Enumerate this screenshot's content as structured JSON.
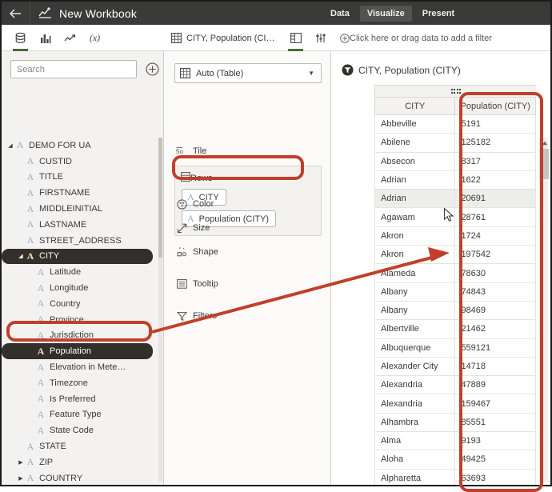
{
  "header": {
    "back_icon": "back-arrow-icon",
    "workbook_icon": "chart-icon",
    "title": "New Workbook",
    "nav": [
      {
        "label": "Data",
        "active": false
      },
      {
        "label": "Visualize",
        "active": true
      },
      {
        "label": "Present",
        "active": false
      }
    ]
  },
  "left_panel": {
    "toolbar_icons": [
      {
        "name": "database-icon",
        "selected": true
      },
      {
        "name": "bar-chart-icon",
        "selected": false
      },
      {
        "name": "trend-line-icon",
        "selected": false
      },
      {
        "name": "formula-icon",
        "selected": false,
        "glyph": "(x)"
      }
    ],
    "search": {
      "placeholder": "Search",
      "value": ""
    },
    "add_button": "add-circle-icon",
    "tree": [
      {
        "label": "DEMO FOR UA",
        "indent": 0,
        "caret": "down",
        "icon": "dataset-icon",
        "selected": false
      },
      {
        "label": "CUSTID",
        "indent": 1,
        "caret": "none",
        "icon": "text-field-icon",
        "selected": false
      },
      {
        "label": "TITLE",
        "indent": 1,
        "caret": "none",
        "icon": "text-field-icon",
        "selected": false
      },
      {
        "label": "FIRSTNAME",
        "indent": 1,
        "caret": "none",
        "icon": "text-field-icon",
        "selected": false
      },
      {
        "label": "MIDDLEINITIAL",
        "indent": 1,
        "caret": "none",
        "icon": "text-field-icon",
        "selected": false
      },
      {
        "label": "LASTNAME",
        "indent": 1,
        "caret": "none",
        "icon": "text-field-icon",
        "selected": false
      },
      {
        "label": "STREET_ADDRESS",
        "indent": 1,
        "caret": "none",
        "icon": "text-field-icon",
        "selected": false
      },
      {
        "label": "CITY",
        "indent": 1,
        "caret": "down",
        "icon": "text-field-icon",
        "selected": true
      },
      {
        "label": "Latitude",
        "indent": 2,
        "caret": "none",
        "icon": "text-field-icon",
        "selected": false
      },
      {
        "label": "Longitude",
        "indent": 2,
        "caret": "none",
        "icon": "text-field-icon",
        "selected": false
      },
      {
        "label": "Country",
        "indent": 2,
        "caret": "none",
        "icon": "text-field-icon",
        "selected": false
      },
      {
        "label": "Province",
        "indent": 2,
        "caret": "none",
        "icon": "text-field-icon",
        "selected": false
      },
      {
        "label": "Jurisdiction",
        "indent": 2,
        "caret": "none",
        "icon": "text-field-icon",
        "selected": false
      },
      {
        "label": "Population",
        "indent": 2,
        "caret": "none",
        "icon": "text-field-icon",
        "selected": true
      },
      {
        "label": "Elevation in Mete…",
        "indent": 2,
        "caret": "none",
        "icon": "text-field-icon",
        "selected": false
      },
      {
        "label": "Timezone",
        "indent": 2,
        "caret": "none",
        "icon": "text-field-icon",
        "selected": false
      },
      {
        "label": "Is Preferred",
        "indent": 2,
        "caret": "none",
        "icon": "text-field-icon",
        "selected": false
      },
      {
        "label": "Feature Type",
        "indent": 2,
        "caret": "none",
        "icon": "text-field-icon",
        "selected": false
      },
      {
        "label": "State Code",
        "indent": 2,
        "caret": "none",
        "icon": "text-field-icon",
        "selected": false
      },
      {
        "label": "STATE",
        "indent": 1,
        "caret": "none",
        "icon": "text-field-icon",
        "selected": false
      },
      {
        "label": "ZIP",
        "indent": 1,
        "caret": "right",
        "icon": "text-field-icon",
        "selected": false
      },
      {
        "label": "COUNTRY",
        "indent": 1,
        "caret": "right",
        "icon": "text-field-icon",
        "selected": false
      }
    ]
  },
  "mid_panel": {
    "tab": {
      "label": "CITY, Population (CI…",
      "icon": "table-icon"
    },
    "tab_icons": [
      {
        "name": "layout-panel-icon",
        "selected": true
      },
      {
        "name": "settings-sliders-icon",
        "selected": false
      }
    ],
    "mark_type": {
      "label": "Auto (Table)",
      "icon": "table-icon",
      "caret": "chevron-down-icon"
    },
    "tile_shelf": {
      "label": "Tile",
      "icon": "tile-icon"
    },
    "rows_shelf": {
      "label": "Rows",
      "icon": "rows-icon",
      "pills": [
        {
          "label": "CITY",
          "icon": "text-field-icon",
          "highlighted": false
        },
        {
          "label": "Population (CITY)",
          "icon": "text-field-icon",
          "highlighted": true
        }
      ]
    },
    "shelves": [
      {
        "label": "Color",
        "icon": "color-palette-icon"
      },
      {
        "label": "Size",
        "icon": "size-icon"
      },
      {
        "label": "Shape",
        "icon": "shape-icon"
      },
      {
        "label": "Tooltip",
        "icon": "tooltip-icon"
      },
      {
        "label": "Filters",
        "icon": "filter-funnel-icon"
      }
    ]
  },
  "right_panel": {
    "filter_bar": {
      "text": "Click here or drag data to add a filter",
      "icon": "add-circle-icon"
    },
    "viz_title": {
      "text": "CITY, Population (CITY)",
      "icon": "filter-badge-icon"
    },
    "drag_handle": "drag-dots-icon",
    "scrollbar": {
      "up_arrow": "scroll-up-icon"
    },
    "cursor": "mouse-pointer-icon"
  },
  "table_data": {
    "type": "table",
    "columns": [
      "CITY",
      "Population (CITY)"
    ],
    "hovered_row_index": 4,
    "rows": [
      [
        "Abbeville",
        "5191"
      ],
      [
        "Abilene",
        "125182"
      ],
      [
        "Absecon",
        "8317"
      ],
      [
        "Adrian",
        "1622"
      ],
      [
        "Adrian",
        "20691"
      ],
      [
        "Agawam",
        "28761"
      ],
      [
        "Akron",
        "1724"
      ],
      [
        "Akron",
        "197542"
      ],
      [
        "Alameda",
        "78630"
      ],
      [
        "Albany",
        "74843"
      ],
      [
        "Albany",
        "98469"
      ],
      [
        "Albertville",
        "21462"
      ],
      [
        "Albuquerque",
        "559121"
      ],
      [
        "Alexander City",
        "14718"
      ],
      [
        "Alexandria",
        "47889"
      ],
      [
        "Alexandria",
        "159467"
      ],
      [
        "Alhambra",
        "85551"
      ],
      [
        "Alma",
        "9193"
      ],
      [
        "Aloha",
        "49425"
      ],
      [
        "Alpharetta",
        "63693"
      ]
    ]
  },
  "annotations": {
    "color": "#c0402b",
    "boxes": [
      {
        "name": "annotation-box-population-field"
      },
      {
        "name": "annotation-box-population-pill"
      },
      {
        "name": "annotation-box-population-column"
      }
    ],
    "arrow": {
      "name": "annotation-arrow"
    }
  }
}
